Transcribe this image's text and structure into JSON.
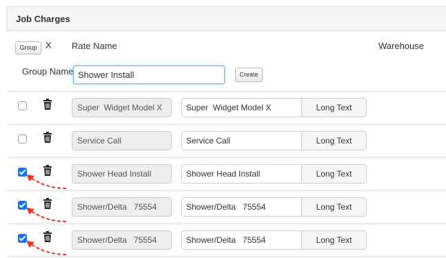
{
  "panel": {
    "title": "Job Charges"
  },
  "header": {
    "group_button": "Group",
    "x_label": "X",
    "col_rate_name": "Rate Name",
    "col_warehouse": "Warehouse"
  },
  "group_form": {
    "label": "Group Name",
    "input_value": "Shower Install",
    "create_button": "Create"
  },
  "rows": [
    {
      "checked": false,
      "rate_name": "Super  Widget Model X",
      "description": "Super  Widget Model X",
      "long_text_button": "Long Text"
    },
    {
      "checked": false,
      "rate_name": "Service Call",
      "description": "Service Call",
      "long_text_button": "Long Text"
    },
    {
      "checked": true,
      "rate_name": "Shower Head Install",
      "description": "Shower Head Install",
      "long_text_button": "Long Text"
    },
    {
      "checked": true,
      "rate_name": "Shower/Delta   75554",
      "description": "Shower/Delta   75554",
      "long_text_button": "Long Text"
    },
    {
      "checked": true,
      "rate_name": "Shower/Delta   75554",
      "description": "Shower/Delta   75554",
      "long_text_button": "Long Text"
    }
  ],
  "colors": {
    "checkbox_checked": "#1a73e8",
    "annotation_arrow": "#e8341c",
    "focus_border": "#66afe9",
    "readonly_bg": "#eeeeee"
  },
  "icons": {
    "delete": "trash-icon",
    "annotation": "red-dashed-arrow"
  }
}
